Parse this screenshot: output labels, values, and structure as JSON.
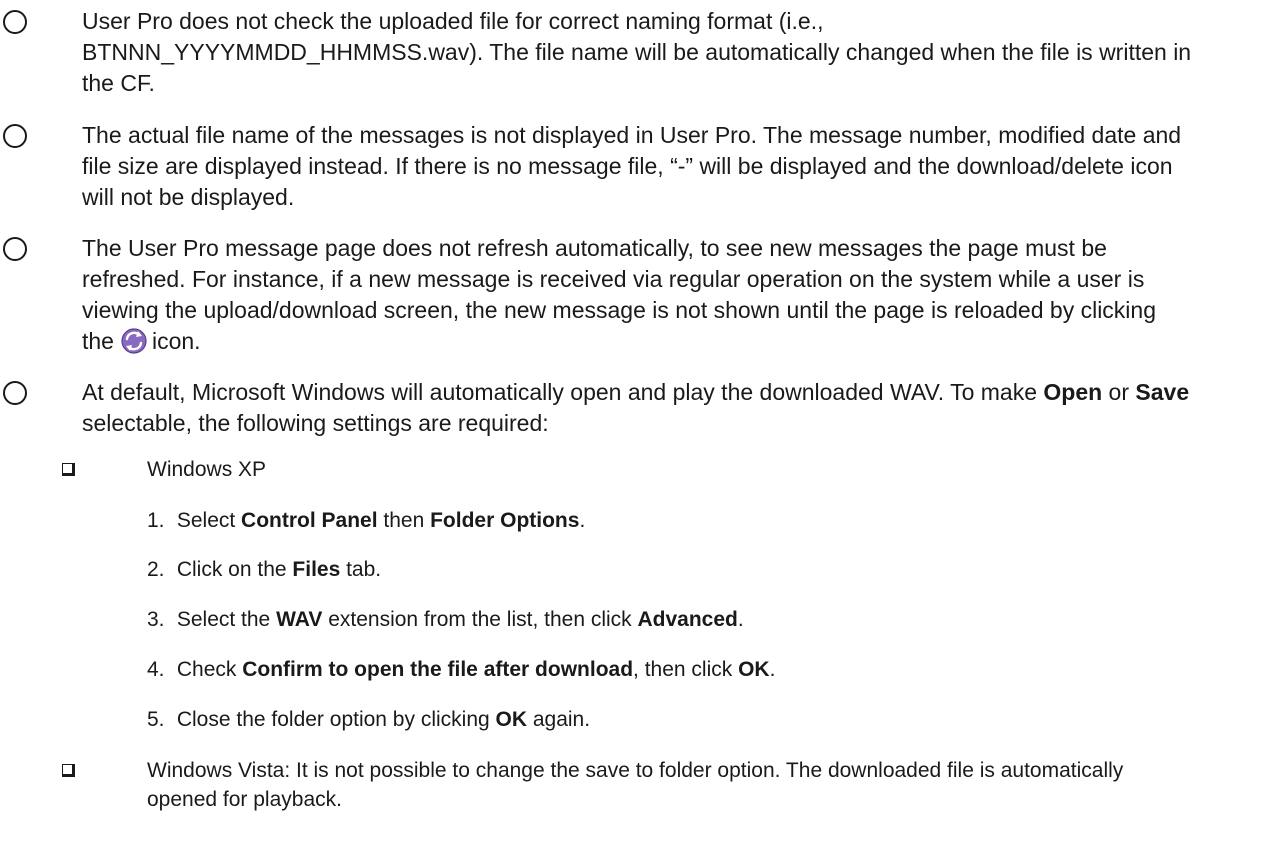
{
  "bullets": [
    {
      "text": "User Pro does not check the uploaded file for correct naming format (i.e., BTNNN_YYYYMMDD_HHMMSS.wav). The file name will be automatically changed when the file is written in the CF."
    },
    {
      "text": "The actual file name of the messages is not displayed in User Pro. The message number, modified date and file size are displayed instead. If there is no message file, “-” will be displayed and the download/delete icon will not be displayed."
    },
    {
      "text_before": "The User Pro message page does not refresh automatically, to see new messages the page must be refreshed. For instance, if a new message is received via regular operation on the system while a user is viewing the upload/download screen, the new message is not shown until the page is reloaded by clicking the",
      "icon": "reload-icon",
      "text_after": "icon."
    },
    {
      "t1": "At default, Microsoft Windows will automatically open and play the downloaded WAV. To make ",
      "b1": "Open",
      "t2": " or ",
      "b2": "Save",
      "t3": " selectable, the following settings are required:"
    }
  ],
  "windows_xp": {
    "title": "Windows XP",
    "steps": [
      {
        "num": "1.",
        "t1": "Select ",
        "b1": "Control Panel",
        "t2": " then ",
        "b2": "Folder Options",
        "t3": "."
      },
      {
        "num": "2.",
        "t1": "Click on the ",
        "b1": "Files",
        "t2": " tab."
      },
      {
        "num": "3.",
        "t1": "Select the ",
        "b1": "WAV",
        "t2": " extension from the list, then click ",
        "b2": "Advanced",
        "t3": "."
      },
      {
        "num": "4.",
        "t1": "Check ",
        "b1": "Confirm to open the file after download",
        "t2": ", then click ",
        "b2": "OK",
        "t3": "."
      },
      {
        "num": "5.",
        "t1": "Close the folder option by clicking ",
        "b1": "OK",
        "t2": " again."
      }
    ]
  },
  "windows_vista": {
    "text": "Windows Vista: It is not possible to change the save to folder option. The downloaded file is automatically opened for playback."
  }
}
